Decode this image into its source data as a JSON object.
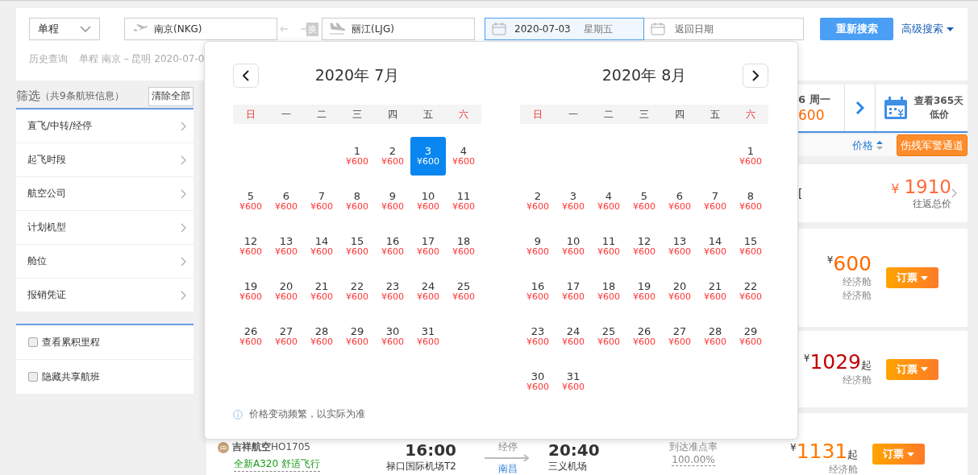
{
  "search": {
    "trip_type": "单程",
    "origin": "南京(NKG)",
    "swap": "换",
    "destination": "丽江(LJG)",
    "depart": {
      "value": "2020-07-03",
      "weekday": "星期五",
      "focused": true
    },
    "return_date": {
      "placeholder": "返回日期"
    },
    "search_button": "重新搜索",
    "advanced_search": "高级搜索"
  },
  "history": {
    "label": "历史查询",
    "entries": [
      "单程 南京 – 昆明 2020-07-0"
    ]
  },
  "filter": {
    "title": "筛选",
    "count": "（共9条航班信息）",
    "clear_button": "清除全部",
    "items": [
      "直飞/中转/经停",
      "起飞时段",
      "航空公司",
      "计划机型",
      "舱位",
      "报销凭证"
    ],
    "options": [
      {
        "label": "查看累积里程",
        "checked": false
      },
      {
        "label": "隐藏共享航班",
        "checked": false
      }
    ]
  },
  "date_strip": {
    "partial_date": "6 周一",
    "partial_price": "600",
    "calendar_button": [
      "查看365天",
      "低价"
    ]
  },
  "sort_bar": {
    "sort_label": "价格",
    "special_button": "伤残军警通道"
  },
  "results": [
    {
      "kind": "summary",
      "fragment": "[",
      "currency": "¥",
      "price": "1910",
      "note": "往返总价"
    },
    {
      "kind": "flight",
      "currency": "¥",
      "price": "600",
      "color": "#ff6a00",
      "cabins": [
        "经济舱",
        "经济舱"
      ],
      "book_button": "订票"
    },
    {
      "kind": "flight",
      "currency": "¥",
      "price": "1029",
      "suffix": "起",
      "color": "#c40000",
      "cabins": [
        "经济舱"
      ],
      "book_button": "订票"
    },
    {
      "kind": "flight",
      "airline": "吉祥航空",
      "flight_no": "HO1705",
      "promo": "全新A320 舒适飞行",
      "depart_time": "16:00",
      "depart_airport": "禄口国际机场T2",
      "stop_label": "经停",
      "stop_city": "南昌",
      "arrive_time": "20:40",
      "arrive_airport": "三义机场",
      "punctuality_label": "到达准点率",
      "punctuality": "100.00%",
      "currency": "¥",
      "price": "1131",
      "suffix": "起",
      "color": "#ff7a00",
      "cabins": [
        "经济舱"
      ],
      "book_button": "订票"
    }
  ],
  "calendar": {
    "note": "价格变动频繁，以实际为准",
    "months": [
      {
        "title": "2020年 7月",
        "kind": "prev",
        "weekdays": [
          {
            "label": "日",
            "weekend": true
          },
          {
            "label": "一",
            "weekend": false
          },
          {
            "label": "二",
            "weekend": false
          },
          {
            "label": "三",
            "weekend": false
          },
          {
            "label": "四",
            "weekend": false
          },
          {
            "label": "五",
            "weekend": false
          },
          {
            "label": "六",
            "weekend": true
          }
        ],
        "days": [
          {
            "kind": "blank"
          },
          {
            "kind": "blank"
          },
          {
            "kind": "blank"
          },
          {
            "kind": "day",
            "day": "1",
            "price": "¥600",
            "selected": false
          },
          {
            "day": "2",
            "price": "¥600",
            "selected": false
          },
          {
            "day": "3",
            "price": "¥600",
            "selected": true
          },
          {
            "day": "4",
            "price": "¥600",
            "selected": false
          },
          {
            "day": "5",
            "price": "¥600",
            "selected": false
          },
          {
            "day": "6",
            "price": "¥600",
            "selected": false
          },
          {
            "day": "7",
            "price": "¥600",
            "selected": false
          },
          {
            "day": "8",
            "price": "¥600",
            "selected": false
          },
          {
            "day": "9",
            "price": "¥600",
            "selected": false
          },
          {
            "day": "10",
            "price": "¥600",
            "selected": false
          },
          {
            "day": "11",
            "price": "¥600",
            "selected": false
          },
          {
            "day": "12",
            "price": "¥600",
            "selected": false
          },
          {
            "day": "13",
            "price": "¥600",
            "selected": false
          },
          {
            "day": "14",
            "price": "¥600",
            "selected": false
          },
          {
            "day": "15",
            "price": "¥600",
            "selected": false
          },
          {
            "day": "16",
            "price": "¥600",
            "selected": false
          },
          {
            "day": "17",
            "price": "¥600",
            "selected": false
          },
          {
            "day": "18",
            "price": "¥600",
            "selected": false
          },
          {
            "day": "19",
            "price": "¥600",
            "selected": false
          },
          {
            "day": "20",
            "price": "¥600",
            "selected": false
          },
          {
            "day": "21",
            "price": "¥600",
            "selected": false
          },
          {
            "day": "22",
            "price": "¥600",
            "selected": false
          },
          {
            "day": "23",
            "price": "¥600",
            "selected": false
          },
          {
            "day": "24",
            "price": "¥600",
            "selected": false
          },
          {
            "day": "25",
            "price": "¥600",
            "selected": false
          },
          {
            "day": "26",
            "price": "¥600",
            "selected": false
          },
          {
            "day": "27",
            "price": "¥600",
            "selected": false
          },
          {
            "day": "28",
            "price": "¥600",
            "selected": false
          },
          {
            "day": "29",
            "price": "¥600",
            "selected": false
          },
          {
            "day": "30",
            "price": "¥600",
            "selected": false
          },
          {
            "day": "31",
            "price": "¥600",
            "selected": false
          }
        ]
      },
      {
        "title": "2020年 8月",
        "kind": "next",
        "weekdays": [
          {
            "label": "日",
            "weekend": true
          },
          {
            "label": "一",
            "weekend": false
          },
          {
            "label": "二",
            "weekend": false
          },
          {
            "label": "三",
            "weekend": false
          },
          {
            "label": "四",
            "weekend": false
          },
          {
            "label": "五",
            "weekend": false
          },
          {
            "label": "六",
            "weekend": true
          }
        ],
        "days": [
          {
            "kind": "blank"
          },
          {
            "kind": "blank"
          },
          {
            "kind": "blank"
          },
          {
            "kind": "blank"
          },
          {
            "kind": "blank"
          },
          {
            "kind": "blank"
          },
          {
            "kind": "day",
            "day": "1",
            "price": "¥600",
            "selected": false
          },
          {
            "day": "2",
            "price": "¥600",
            "selected": false
          },
          {
            "day": "3",
            "price": "¥600",
            "selected": false
          },
          {
            "day": "4",
            "price": "¥600",
            "selected": false
          },
          {
            "day": "5",
            "price": "¥600",
            "selected": false
          },
          {
            "day": "6",
            "price": "¥600",
            "selected": false
          },
          {
            "day": "7",
            "price": "¥600",
            "selected": false
          },
          {
            "day": "8",
            "price": "¥600",
            "selected": false
          },
          {
            "day": "9",
            "price": "¥600",
            "selected": false
          },
          {
            "day": "10",
            "price": "¥600",
            "selected": false
          },
          {
            "day": "11",
            "price": "¥600",
            "selected": false
          },
          {
            "day": "12",
            "price": "¥600",
            "selected": false
          },
          {
            "day": "13",
            "price": "¥600",
            "selected": false
          },
          {
            "day": "14",
            "price": "¥600",
            "selected": false
          },
          {
            "day": "15",
            "price": "¥600",
            "selected": false
          },
          {
            "day": "16",
            "price": "¥600",
            "selected": false
          },
          {
            "day": "17",
            "price": "¥600",
            "selected": false
          },
          {
            "day": "18",
            "price": "¥600",
            "selected": false
          },
          {
            "day": "19",
            "price": "¥600",
            "selected": false
          },
          {
            "day": "20",
            "price": "¥600",
            "selected": false
          },
          {
            "day": "21",
            "price": "¥600",
            "selected": false
          },
          {
            "day": "22",
            "price": "¥600",
            "selected": false
          },
          {
            "day": "23",
            "price": "¥600",
            "selected": false
          },
          {
            "day": "24",
            "price": "¥600",
            "selected": false
          },
          {
            "day": "25",
            "price": "¥600",
            "selected": false
          },
          {
            "day": "26",
            "price": "¥600",
            "selected": false
          },
          {
            "day": "27",
            "price": "¥600",
            "selected": false
          },
          {
            "day": "28",
            "price": "¥600",
            "selected": false
          },
          {
            "day": "29",
            "price": "¥600",
            "selected": false
          },
          {
            "day": "30",
            "price": "¥600",
            "selected": false
          },
          {
            "day": "31",
            "price": "¥600",
            "selected": false
          }
        ]
      }
    ]
  }
}
